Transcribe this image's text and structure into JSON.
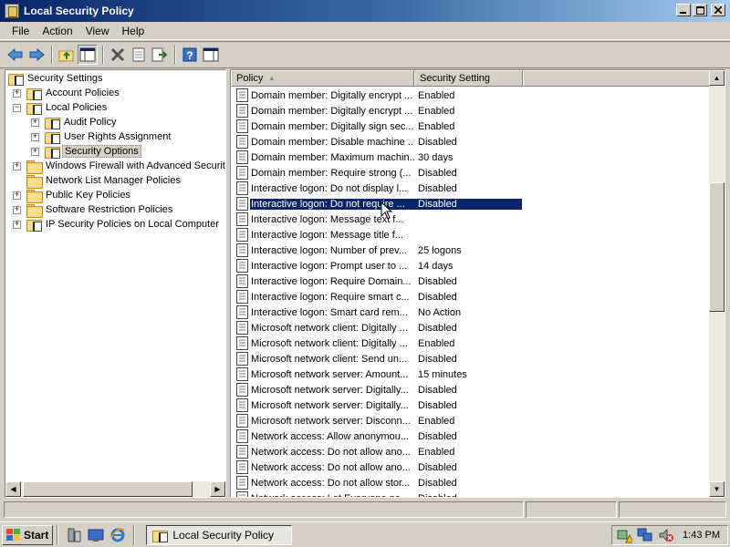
{
  "window": {
    "title": "Local Security Policy"
  },
  "menu": [
    "File",
    "Action",
    "View",
    "Help"
  ],
  "toolbar": {
    "buttons": [
      "back-icon",
      "forward-icon",
      "up-folder-icon",
      "show-hide-console-tree-icon",
      "delete-icon",
      "properties-icon",
      "export-list-icon",
      "help-icon",
      "show-hide-action-pane-icon"
    ]
  },
  "tree": {
    "root": "Security Settings",
    "items": [
      {
        "label": "Account Policies",
        "expander": "+",
        "level": 1
      },
      {
        "label": "Local Policies",
        "expander": "−",
        "level": 1
      },
      {
        "label": "Audit Policy",
        "expander": "+",
        "level": 2
      },
      {
        "label": "User Rights Assignment",
        "expander": "+",
        "level": 2
      },
      {
        "label": "Security Options",
        "expander": "+",
        "level": 2,
        "selected": true
      },
      {
        "label": "Windows Firewall with Advanced Security",
        "expander": "+",
        "level": 1
      },
      {
        "label": "Network List Manager Policies",
        "expander": "",
        "level": 1
      },
      {
        "label": "Public Key Policies",
        "expander": "+",
        "level": 1
      },
      {
        "label": "Software Restriction Policies",
        "expander": "+",
        "level": 1
      },
      {
        "label": "IP Security Policies on Local Computer",
        "expander": "+",
        "level": 1
      }
    ]
  },
  "list": {
    "columns": {
      "policy": "Policy",
      "setting": "Security Setting"
    },
    "rows": [
      {
        "policy": "Domain member: Digitally encrypt ...",
        "setting": "Enabled"
      },
      {
        "policy": "Domain member: Digitally encrypt ...",
        "setting": "Enabled"
      },
      {
        "policy": "Domain member: Digitally sign sec...",
        "setting": "Enabled"
      },
      {
        "policy": "Domain member: Disable machine ...",
        "setting": "Disabled"
      },
      {
        "policy": "Domain member: Maximum machin...",
        "setting": "30 days"
      },
      {
        "policy": "Domain member: Require strong (...",
        "setting": "Disabled"
      },
      {
        "policy": "Interactive logon: Do not display l...",
        "setting": "Disabled"
      },
      {
        "policy": "Interactive logon: Do not require ...",
        "setting": "Disabled",
        "selected": true
      },
      {
        "policy": "Interactive logon: Message text f...",
        "setting": ""
      },
      {
        "policy": "Interactive logon: Message title f...",
        "setting": ""
      },
      {
        "policy": "Interactive logon: Number of prev...",
        "setting": "25 logons"
      },
      {
        "policy": "Interactive logon: Prompt user to ...",
        "setting": "14 days"
      },
      {
        "policy": "Interactive logon: Require Domain...",
        "setting": "Disabled"
      },
      {
        "policy": "Interactive logon: Require smart c...",
        "setting": "Disabled"
      },
      {
        "policy": "Interactive logon: Smart card rem...",
        "setting": "No Action"
      },
      {
        "policy": "Microsoft network client: Digitally ...",
        "setting": "Disabled"
      },
      {
        "policy": "Microsoft network client: Digitally ...",
        "setting": "Enabled"
      },
      {
        "policy": "Microsoft network client: Send un...",
        "setting": "Disabled"
      },
      {
        "policy": "Microsoft network server: Amount...",
        "setting": "15 minutes"
      },
      {
        "policy": "Microsoft network server: Digitally...",
        "setting": "Disabled"
      },
      {
        "policy": "Microsoft network server: Digitally...",
        "setting": "Disabled"
      },
      {
        "policy": "Microsoft network server: Disconn...",
        "setting": "Enabled"
      },
      {
        "policy": "Network access: Allow anonymou...",
        "setting": "Disabled"
      },
      {
        "policy": "Network access: Do not allow ano...",
        "setting": "Enabled"
      },
      {
        "policy": "Network access: Do not allow ano...",
        "setting": "Disabled"
      },
      {
        "policy": "Network access: Do not allow stor...",
        "setting": "Disabled"
      },
      {
        "policy": "Network access: Let Everyone pe...",
        "setting": "Disabled"
      }
    ]
  },
  "taskbar": {
    "start_label": "Start",
    "quicklaunch": [
      "server-manager-icon",
      "show-desktop-icon",
      "internet-explorer-icon"
    ],
    "task_label": "Local Security Policy",
    "tray_icons": [
      "network-warning-icon",
      "network-connection-icon",
      "volume-muted-icon"
    ],
    "clock": "1:43 PM"
  },
  "colors": {
    "title_start": "#0a246a",
    "title_end": "#a6caf0",
    "selection": "#0a246a",
    "face": "#d4d0c8"
  }
}
